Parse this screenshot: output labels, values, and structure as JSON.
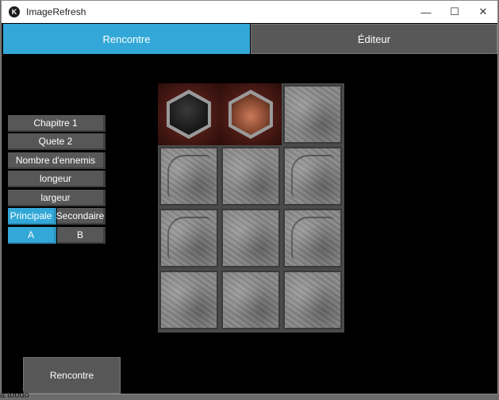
{
  "window": {
    "title": "ImageRefresh",
    "app_icon": "kivy-icon"
  },
  "tabs": [
    {
      "label": "Rencontre",
      "active": true
    },
    {
      "label": "Éditeur",
      "active": false
    }
  ],
  "left_panel": {
    "chapter": "Chapitre 1",
    "quest": "Quete 2",
    "enemy_count": "Nombre d'ennemis",
    "length": "longeur",
    "width": "largeur",
    "type_toggle": {
      "primary": "Principale",
      "secondary": "Secondaire",
      "selected": "Principale"
    },
    "variant_toggle": {
      "a": "A",
      "b": "B",
      "selected": "A"
    }
  },
  "board": {
    "rows": 4,
    "cols": 3,
    "tokens": [
      "dark-monster-token",
      "orc-monster-token"
    ]
  },
  "bottom": {
    "button_label": "Rencontre",
    "peek_text": "a toodo"
  },
  "colors": {
    "accent": "#33a8d8",
    "button": "#575757",
    "background": "#000000"
  }
}
